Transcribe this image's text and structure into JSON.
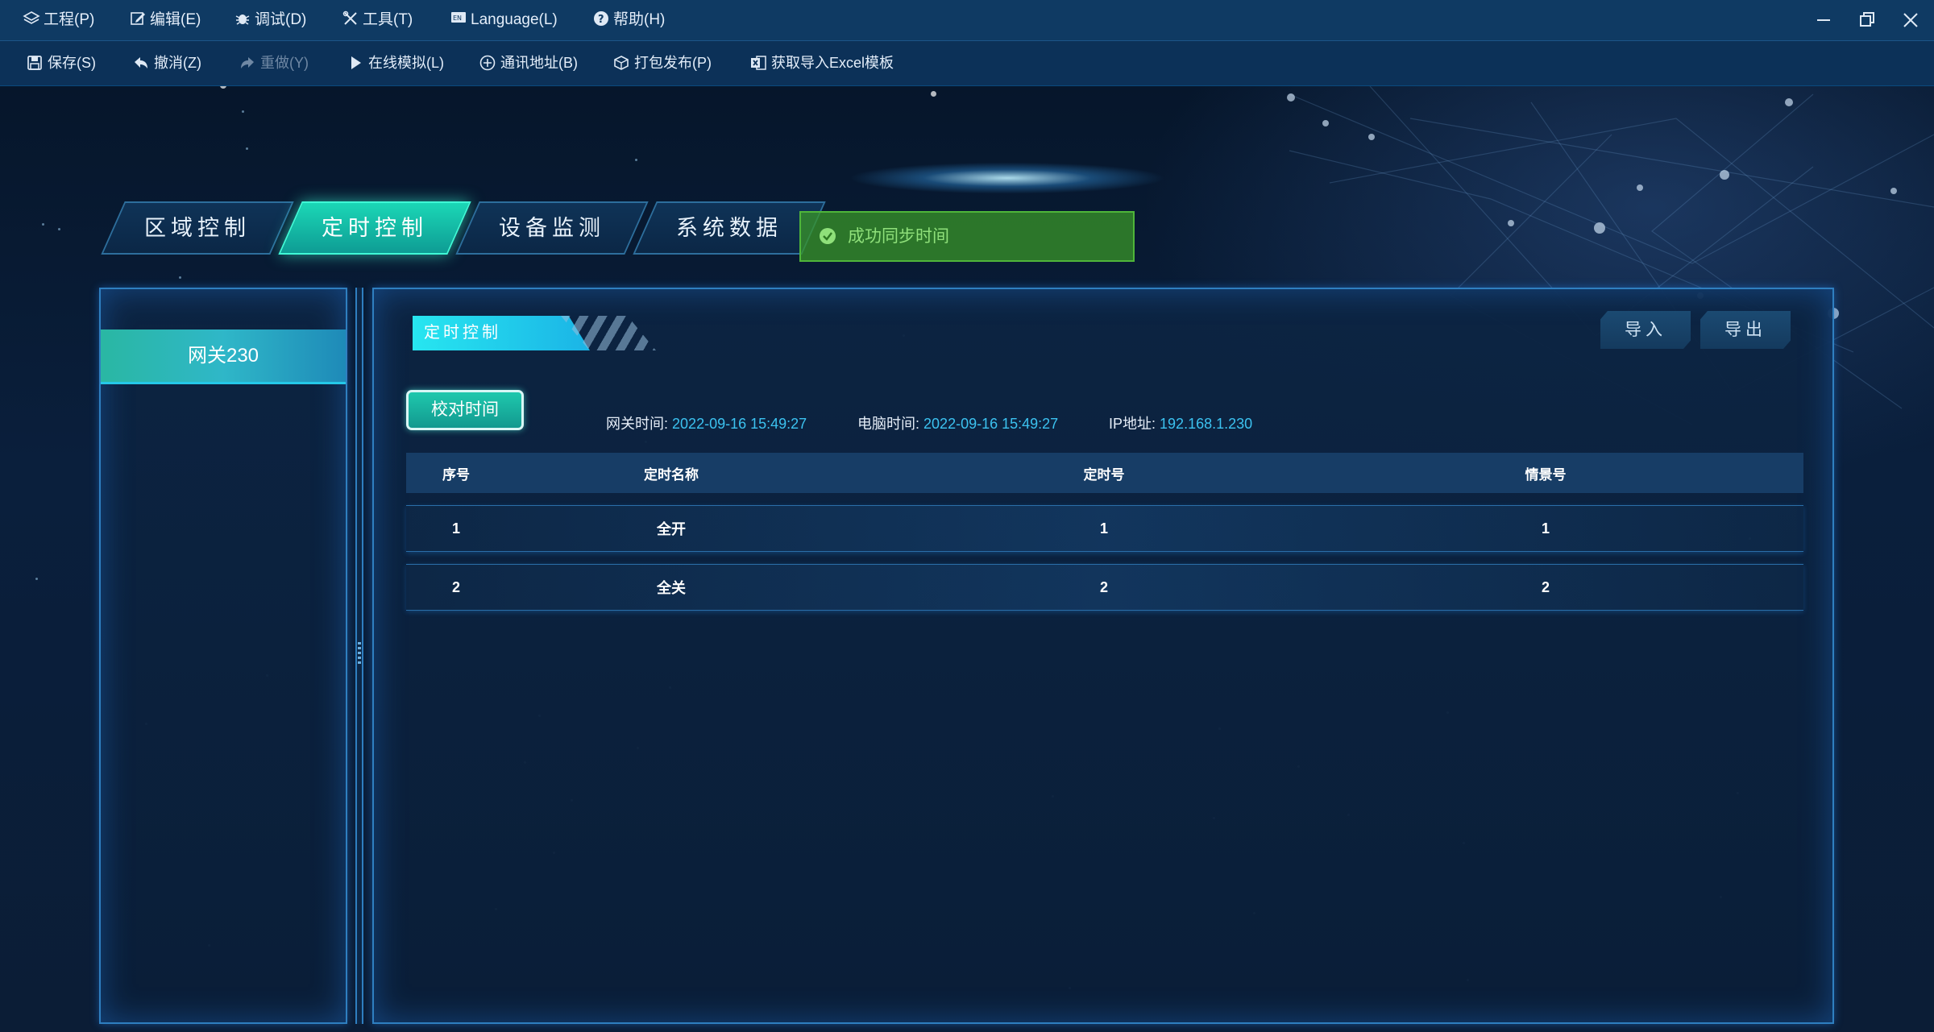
{
  "menubar": {
    "items": [
      {
        "label": "工程(P)",
        "icon": "layers-icon"
      },
      {
        "label": "编辑(E)",
        "icon": "edit-icon"
      },
      {
        "label": "调试(D)",
        "icon": "bug-icon"
      },
      {
        "label": "工具(T)",
        "icon": "tools-icon"
      },
      {
        "label": "Language(L)",
        "icon": "language-icon"
      },
      {
        "label": "帮助(H)",
        "icon": "help-icon"
      }
    ]
  },
  "toolbar": {
    "items": [
      {
        "label": "保存(S)",
        "icon": "save-icon"
      },
      {
        "label": "撤消(Z)",
        "icon": "undo-icon"
      },
      {
        "label": "重做(Y)",
        "icon": "redo-icon"
      },
      {
        "label": "在线模拟(L)",
        "icon": "play-icon"
      },
      {
        "label": "通讯地址(B)",
        "icon": "plus-circle-icon"
      },
      {
        "label": "打包发布(P)",
        "icon": "package-icon"
      },
      {
        "label": "获取导入Excel模板",
        "icon": "excel-icon"
      }
    ]
  },
  "tabs": [
    {
      "label": "区域控制"
    },
    {
      "label": "定时控制"
    },
    {
      "label": "设备监测"
    },
    {
      "label": "系统数据"
    }
  ],
  "toast": {
    "message": "成功同步时间",
    "color": "#4fb53a"
  },
  "sidebar": {
    "gateway": "网关230"
  },
  "main": {
    "section_title": "定时控制",
    "import_label": "导入",
    "export_label": "导出",
    "sync_button": "校对时间",
    "gateway_time_label": "网关时间:",
    "gateway_time": "2022-09-16 15:49:27",
    "pc_time_label": "电脑时间:",
    "pc_time": "2022-09-16 15:49:27",
    "ip_label": "IP地址:",
    "ip": "192.168.1.230",
    "table": {
      "columns": [
        "序号",
        "定时名称",
        "定时号",
        "情景号"
      ],
      "rows": [
        [
          "1",
          "全开",
          "1",
          "1"
        ],
        [
          "2",
          "全关",
          "2",
          "2"
        ]
      ]
    }
  },
  "colors": {
    "accent": "#1bd7b6",
    "panel_border": "#2f7fc0",
    "value_text": "#3cc2f0"
  }
}
